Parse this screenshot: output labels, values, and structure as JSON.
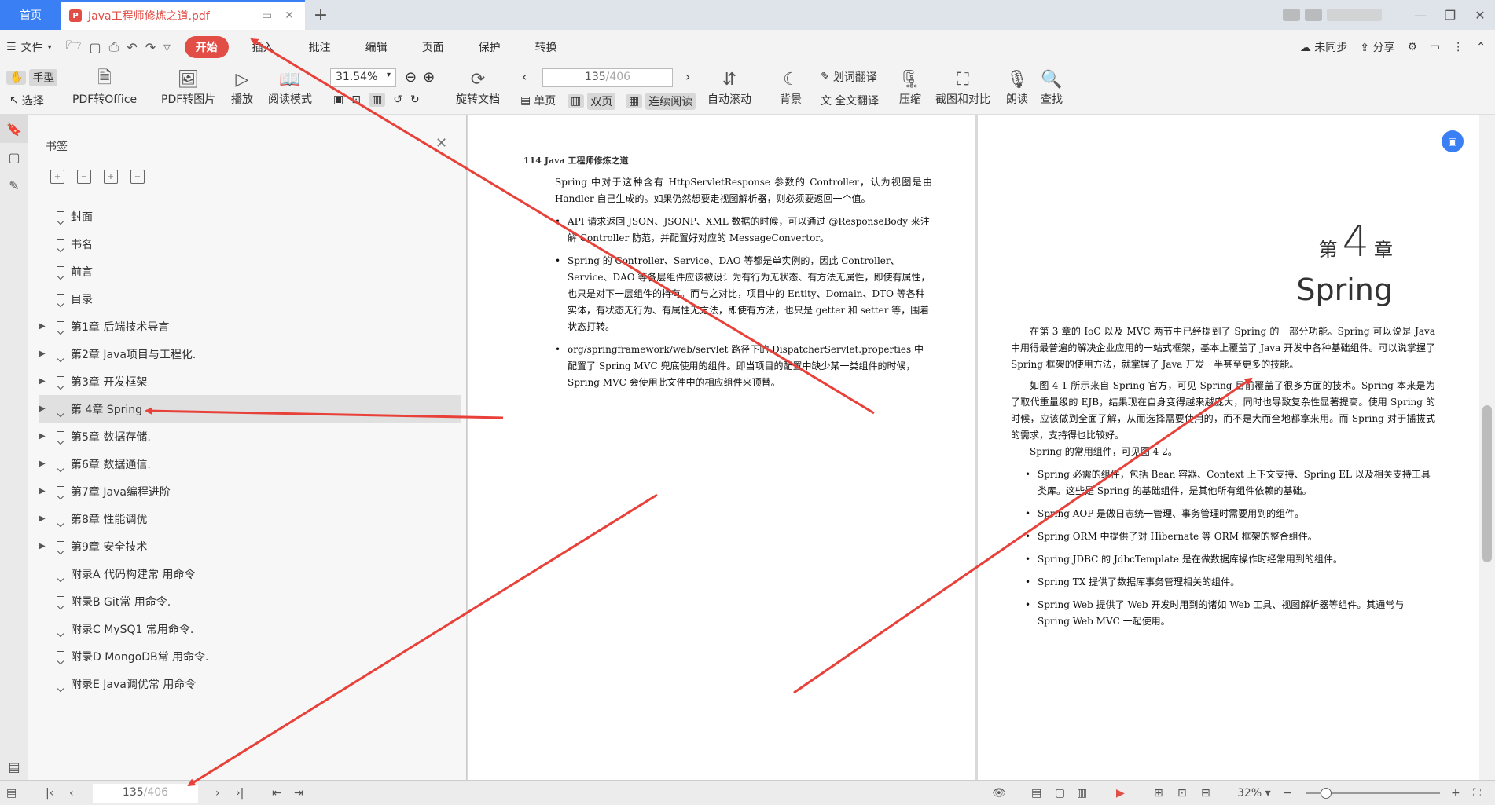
{
  "titlebar": {
    "home_tab": "首页",
    "doc_tab": "Java工程师修炼之道.pdf",
    "pdf_badge": "P"
  },
  "menubar": {
    "file": "文件",
    "items": [
      "开始",
      "插入",
      "批注",
      "编辑",
      "页面",
      "保护",
      "转换"
    ],
    "active": "开始",
    "right": {
      "sync": "未同步",
      "share": "分享"
    }
  },
  "ribbon": {
    "hand": "手型",
    "select": "选择",
    "pdf_to_office": "PDF转Office",
    "pdf_to_image": "PDF转图片",
    "play": "播放",
    "read_mode": "阅读模式",
    "zoom": "31.54%",
    "rotate": "旋转文档",
    "page_current": "135",
    "page_total": "/406",
    "single": "单页",
    "double": "双页",
    "continuous": "连续阅读",
    "auto_scroll": "自动滚动",
    "background": "背景",
    "word_translate": "划词翻译",
    "full_translate": "全文翻译",
    "compress": "压缩",
    "screenshot_compare": "截图和对比",
    "read_aloud": "朗读",
    "find": "查找"
  },
  "bookmarks": {
    "title": "书签",
    "items": [
      {
        "label": "封面",
        "expandable": false
      },
      {
        "label": "书名",
        "expandable": false
      },
      {
        "label": "前言",
        "expandable": false
      },
      {
        "label": "目录",
        "expandable": false
      },
      {
        "label": "第1章 后端技术导言",
        "expandable": true
      },
      {
        "label": "第2章 Java项目与工程化.",
        "expandable": true
      },
      {
        "label": "第3章 开发框架",
        "expandable": true
      },
      {
        "label": "第 4章 Spring",
        "expandable": true,
        "selected": true
      },
      {
        "label": "第5章 数据存储.",
        "expandable": true
      },
      {
        "label": "第6章 数据通信.",
        "expandable": true
      },
      {
        "label": "第7章 Java编程进阶",
        "expandable": true
      },
      {
        "label": "第8章 性能调优",
        "expandable": true
      },
      {
        "label": "第9章 安全技术",
        "expandable": true
      },
      {
        "label": "附录A 代码构建常 用命令",
        "expandable": false
      },
      {
        "label": "附录B Git常 用命令.",
        "expandable": false
      },
      {
        "label": "附录C MySQ1 常用命令.",
        "expandable": false
      },
      {
        "label": "附录D MongoDB常 用命令.",
        "expandable": false
      },
      {
        "label": "附录E Java调优常 用命令",
        "expandable": false
      }
    ]
  },
  "left_page": {
    "running_head": "114   Java 工程师修炼之道",
    "intro": "Spring 中对于这种含有 HttpServletResponse 参数的 Controller，认为视图是由 Handler 自己生成的。如果仍然想要走视图解析器，则必须要返回一个值。",
    "bullets": [
      "API 请求返回 JSON、JSONP、XML 数据的时候，可以通过 @ResponseBody 来注解 Controller 防范，并配置好对应的 MessageConvertor。",
      "Spring 的 Controller、Service、DAO 等都是单实例的，因此 Controller、Service、DAO 等各层组件应该被设计为有行为无状态、有方法无属性，即使有属性，也只是对下一层组件的持有。而与之对比，项目中的 Entity、Domain、DTO 等各种实体，有状态无行为、有属性无方法，即使有方法，也只是 getter 和 setter 等，围着状态打转。",
      "org/springframework/web/servlet 路径下的 DispatcherServlet.properties 中配置了 Spring MVC 兜底使用的组件。即当项目的配置中缺少某一类组件的时候，Spring MVC 会使用此文件中的相应组件来顶替。"
    ]
  },
  "right_page": {
    "chapter_prefix": "第",
    "chapter_num": "4",
    "chapter_suffix": "章",
    "chapter_title": "Spring",
    "paras": [
      "在第 3 章的 IoC 以及 MVC 两节中已经提到了 Spring 的一部分功能。Spring 可以说是 Java 中用得最普遍的解决企业应用的一站式框架，基本上覆盖了 Java 开发中各种基础组件。可以说掌握了 Spring 框架的使用方法，就掌握了 Java 开发一半甚至更多的技能。",
      "如图 4-1 所示来自 Spring 官方，可见 Spring 目前覆盖了很多方面的技术。Spring 本来是为了取代重量级的 EJB，结果现在自身变得越来越庞大，同时也导致复杂性显著提高。使用 Spring 的时候，应该做到全面了解，从而选择需要使用的，而不是大而全地都拿来用。而 Spring 对于插拔式的需求，支持得也比较好。",
      "Spring 的常用组件，可见图 4-2。"
    ],
    "bullets": [
      "Spring 必需的组件，包括 Bean 容器、Context 上下文支持、Spring EL 以及相关支持工具类库。这些是 Spring 的基础组件，是其他所有组件依赖的基础。",
      "Spring AOP 是做日志统一管理、事务管理时需要用到的组件。",
      "Spring ORM 中提供了对 Hibernate 等 ORM 框架的整合组件。",
      "Spring JDBC 的 JdbcTemplate 是在做数据库操作时经常用到的组件。",
      "Spring TX 提供了数据库事务管理相关的组件。",
      "Spring Web 提供了 Web 开发时用到的诸如 Web 工具、视图解析器等组件。其通常与 Spring Web MVC 一起使用。"
    ]
  },
  "statusbar": {
    "page_current": "135",
    "page_total": "/406",
    "zoom": "32%"
  },
  "colors": {
    "accent": "#3a7ff3",
    "active_tab": "#e24d45",
    "annotation_arrow": "#e8413a"
  }
}
